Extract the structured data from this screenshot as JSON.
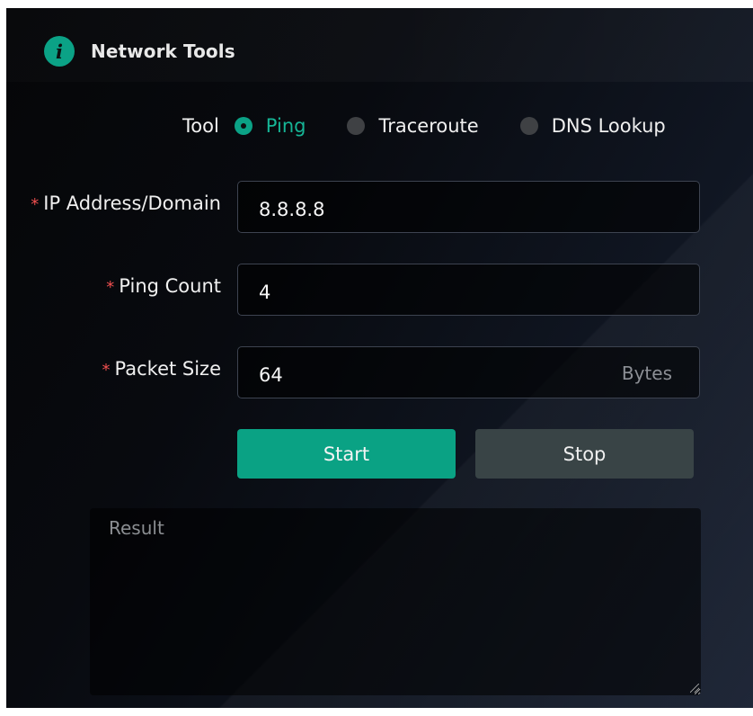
{
  "header": {
    "title": "Network Tools",
    "icon": "info-icon",
    "icon_text": "i",
    "icon_color": "#0ba286"
  },
  "tool": {
    "label": "Tool",
    "options": [
      {
        "label": "Ping",
        "selected": true
      },
      {
        "label": "Traceroute",
        "selected": false
      },
      {
        "label": "DNS Lookup",
        "selected": false
      }
    ]
  },
  "form": {
    "ip_domain": {
      "required_mark": "*",
      "label": "IP Address/Domain",
      "value": "8.8.8.8"
    },
    "ping_count": {
      "required_mark": "*",
      "label": "Ping Count",
      "value": "4"
    },
    "packet_size": {
      "required_mark": "*",
      "label": "Packet Size",
      "value": "64",
      "suffix": "Bytes"
    }
  },
  "actions": {
    "start_label": "Start",
    "stop_label": "Stop"
  },
  "result": {
    "placeholder": "Result",
    "value": ""
  },
  "colors": {
    "accent": "#0ba286",
    "required": "#f04f4f",
    "stop_button": "#394446",
    "background_dark": "#080a0f"
  }
}
